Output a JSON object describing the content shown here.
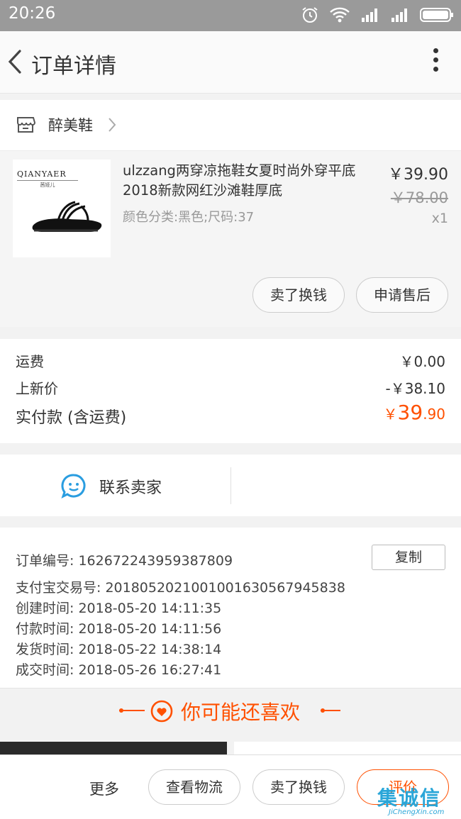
{
  "status_bar": {
    "time": "20:26"
  },
  "nav": {
    "title": "订单详情"
  },
  "shop": {
    "name": "醉美鞋"
  },
  "product": {
    "brand": "QIANYAER",
    "brand_sub": "茜娅儿",
    "title": "ulzzang两穿凉拖鞋女夏时尚外穿平底2018新款网红沙滩鞋厚底",
    "attributes": "颜色分类:黑色;尺码:37",
    "price": "￥39.90",
    "original_price": "￥78.00",
    "quantity": "x1",
    "actions": {
      "sell": "卖了换钱",
      "after_sale": "申请售后"
    }
  },
  "totals": {
    "shipping_label": "运费",
    "shipping_value": "￥0.00",
    "discount_label": "上新价",
    "discount_value": "-￥38.10",
    "paid_label": "实付款 (含运费)",
    "paid_currency": "￥",
    "paid_int": "39",
    "paid_dec": ".90"
  },
  "contact": {
    "label": "联系卖家"
  },
  "order_info": {
    "order_no": "订单编号:  1626722439593878​09",
    "copy_label": "复制",
    "alipay_no": "支付宝交易号:  2018052021001001630567945838",
    "created": "创建时间:  2018-05-20 14:11:35",
    "paid": "付款时间:  2018-05-20 14:11:56",
    "shipped": "发货时间:  2018-05-22 14:38:14",
    "completed": "成交时间:  2018-05-26 16:27:41"
  },
  "recommend": {
    "title": "你可能还喜欢"
  },
  "bottom_bar": {
    "more": "更多",
    "logistics": "查看物流",
    "sell": "卖了换钱",
    "rate": "评价"
  },
  "watermark": {
    "main": "集诚信",
    "sub": "JiChengXin.com"
  },
  "colors": {
    "accent": "#ff5000",
    "status_bar": "#9a9a9a",
    "contact_icon": "#2a9de0"
  }
}
